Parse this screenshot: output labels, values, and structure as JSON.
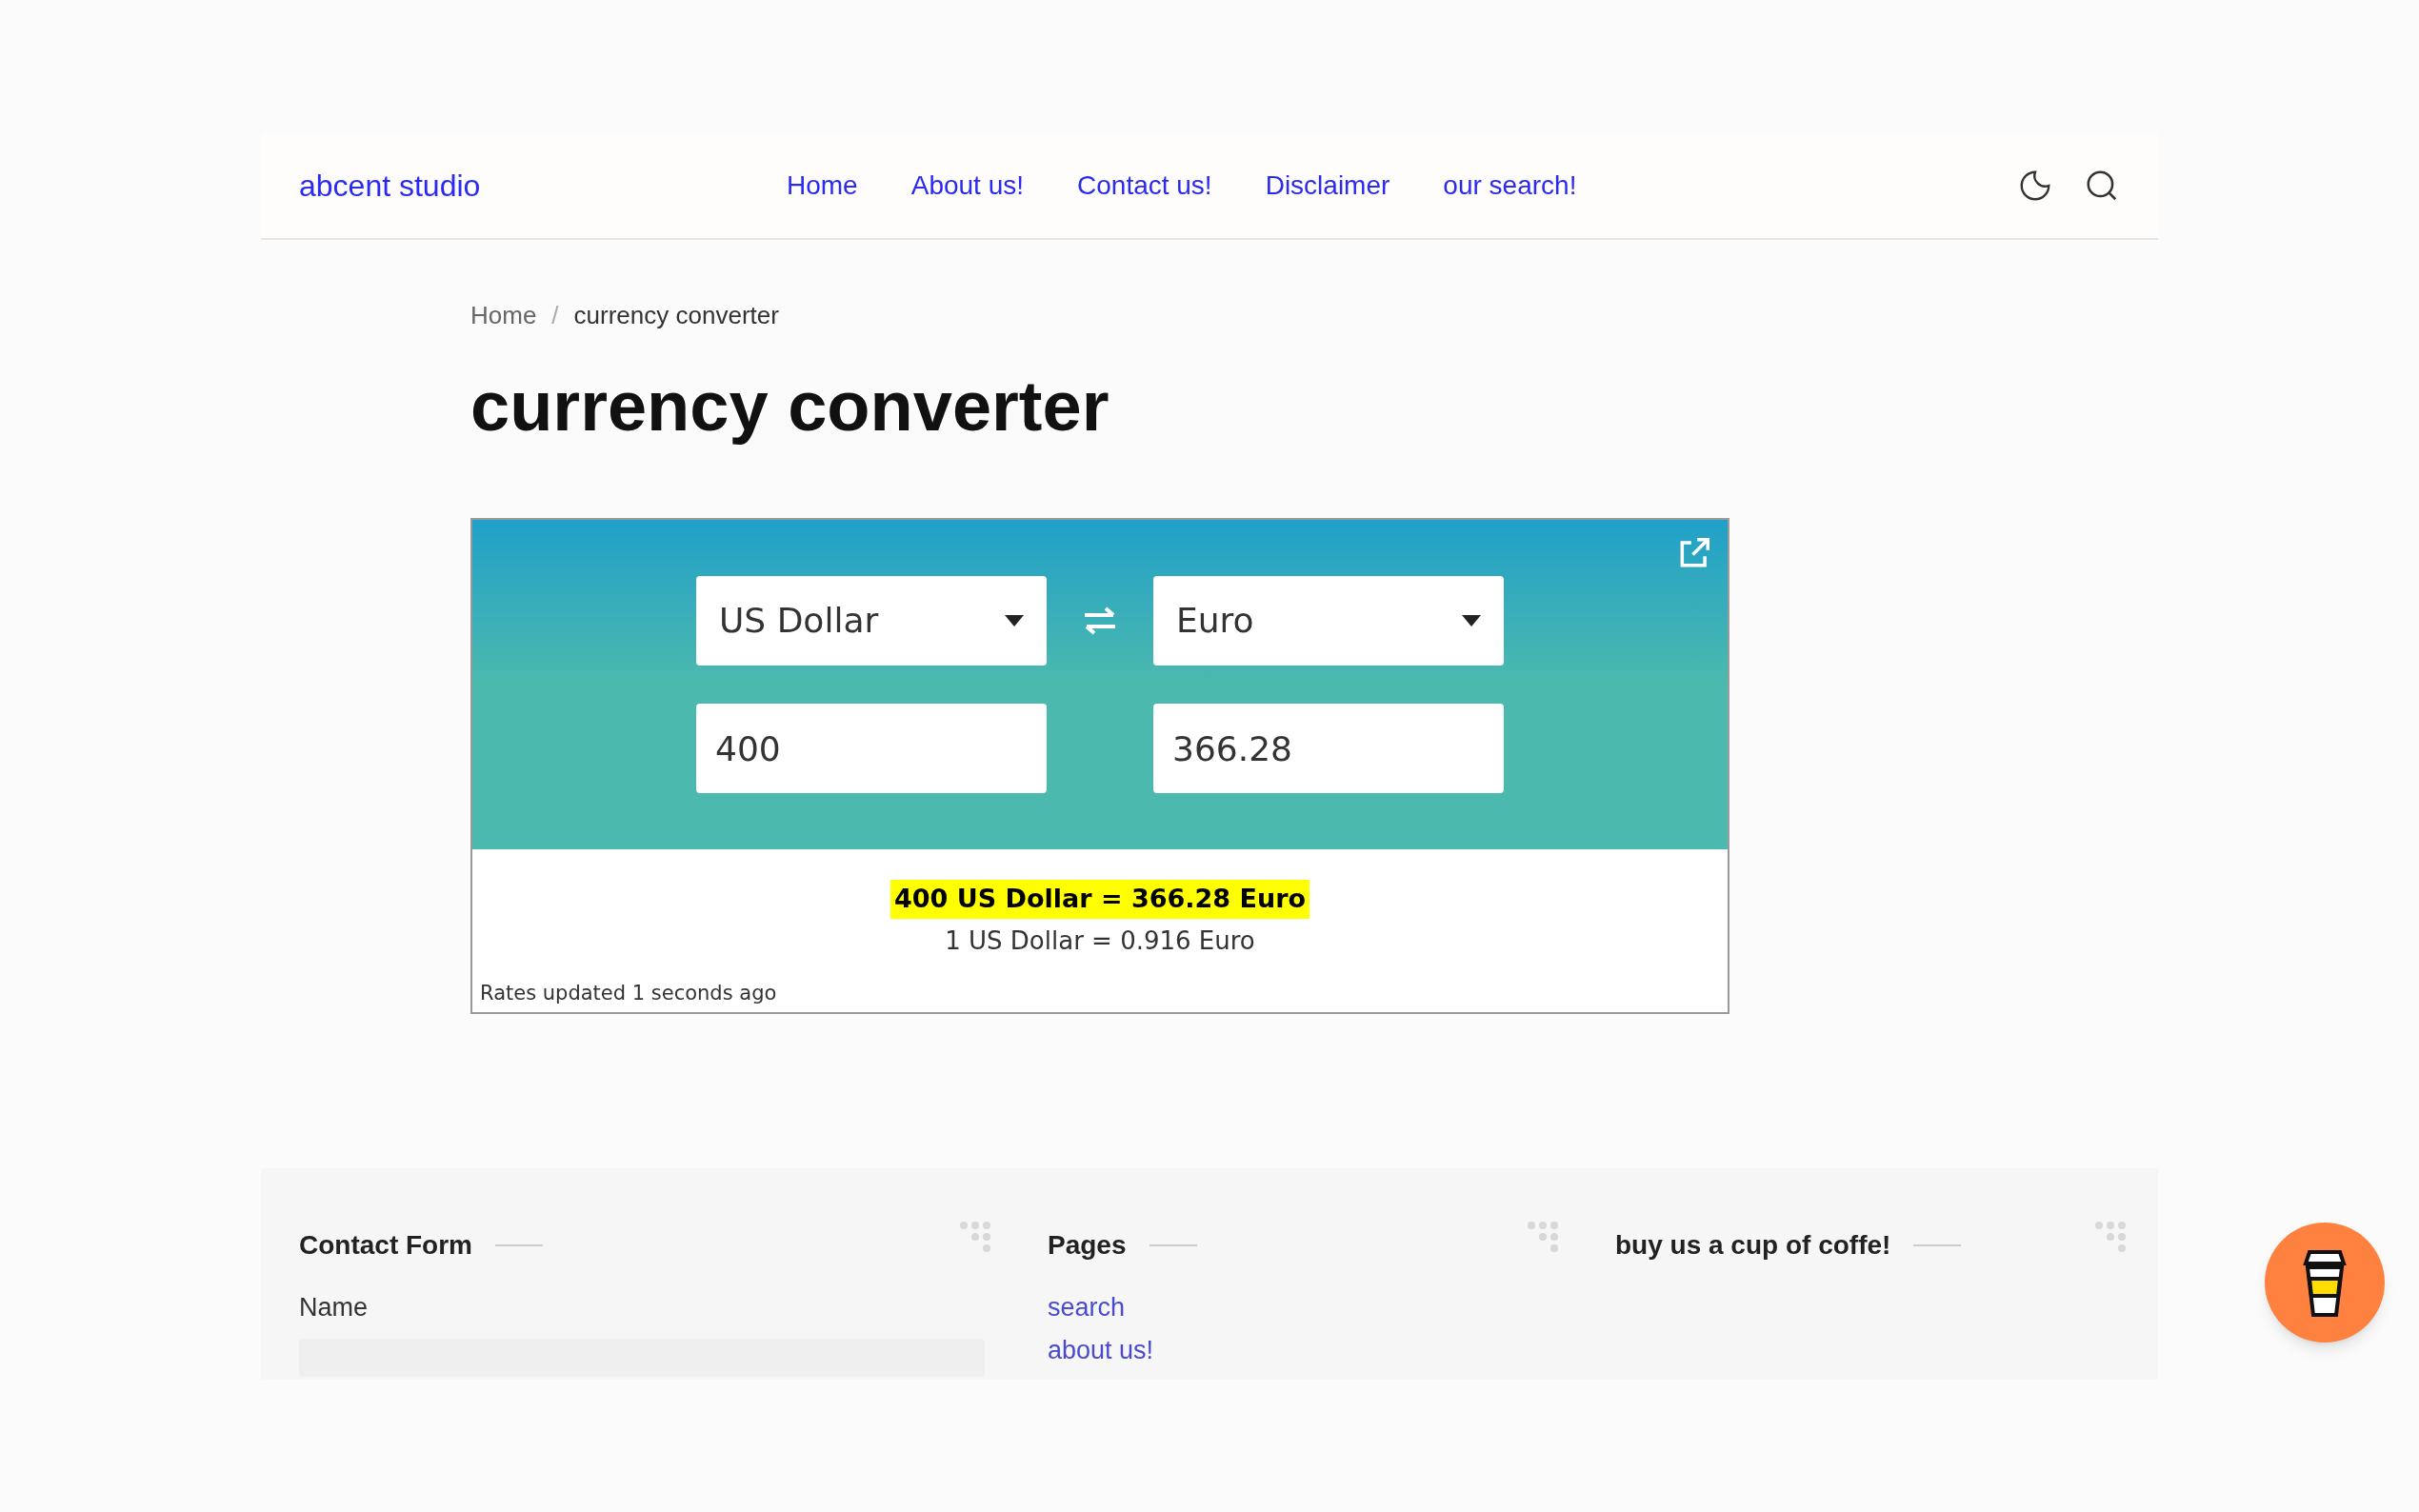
{
  "header": {
    "logo": "abcent studio",
    "nav": [
      {
        "label": "Home"
      },
      {
        "label": "About us!"
      },
      {
        "label": "Contact us!"
      },
      {
        "label": "Disclaimer"
      },
      {
        "label": "our search!"
      }
    ]
  },
  "breadcrumb": [
    "Home",
    "/",
    "currency converter"
  ],
  "title": "currency converter",
  "converter": {
    "from_currency": "US Dollar",
    "to_currency": "Euro",
    "from_amount": "400",
    "to_amount": "366.28",
    "result": "400 US Dollar = 366.28 Euro",
    "rate": "1 US Dollar = 0.916 Euro",
    "updated": "Rates updated 1 seconds ago"
  },
  "footer": {
    "columns": [
      {
        "kind": "form",
        "title": "Contact Form",
        "field_label": "Name"
      },
      {
        "kind": "links",
        "title": "Pages",
        "links": [
          "search",
          "about us!"
        ]
      },
      {
        "kind": "plain",
        "title": "buy us a cup of coffe!"
      }
    ]
  }
}
